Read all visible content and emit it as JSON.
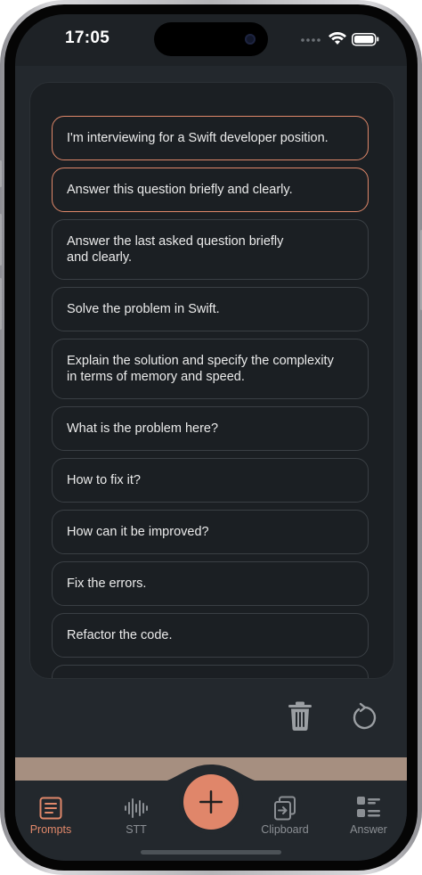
{
  "status_bar": {
    "time": "17:05"
  },
  "prompts": [
    {
      "text": "I'm interviewing for a Swift developer position.",
      "selected": true
    },
    {
      "text": "Answer this question briefly and clearly.",
      "selected": true
    },
    {
      "text": "Answer the last asked question briefly\nand clearly.",
      "selected": false
    },
    {
      "text": "Solve the problem in Swift.",
      "selected": false
    },
    {
      "text": "Explain the solution and specify the complexity\nin terms of memory and speed.",
      "selected": false
    },
    {
      "text": "What is the problem here?",
      "selected": false
    },
    {
      "text": "How to fix it?",
      "selected": false
    },
    {
      "text": "How can it be improved?",
      "selected": false
    },
    {
      "text": "Fix the errors.",
      "selected": false
    },
    {
      "text": "Refactor the code.",
      "selected": false
    },
    {
      "text": "",
      "selected": false
    }
  ],
  "actions": {
    "delete_icon": "trash-icon",
    "reset_icon": "reset-icon"
  },
  "tabbar": {
    "tabs": [
      {
        "label": "Prompts",
        "icon": "prompts-icon",
        "active": true
      },
      {
        "label": "STT",
        "icon": "waveform-icon",
        "active": false
      },
      {
        "label": "Clipboard",
        "icon": "clipboard-icon",
        "active": false
      },
      {
        "label": "Answer",
        "icon": "answer-list-icon",
        "active": false
      }
    ],
    "add_icon": "plus-icon"
  },
  "colors": {
    "accent": "#e0886a",
    "background": "#1e2226",
    "card": "#1b1f23",
    "tab_inactive": "#8b8f94"
  }
}
